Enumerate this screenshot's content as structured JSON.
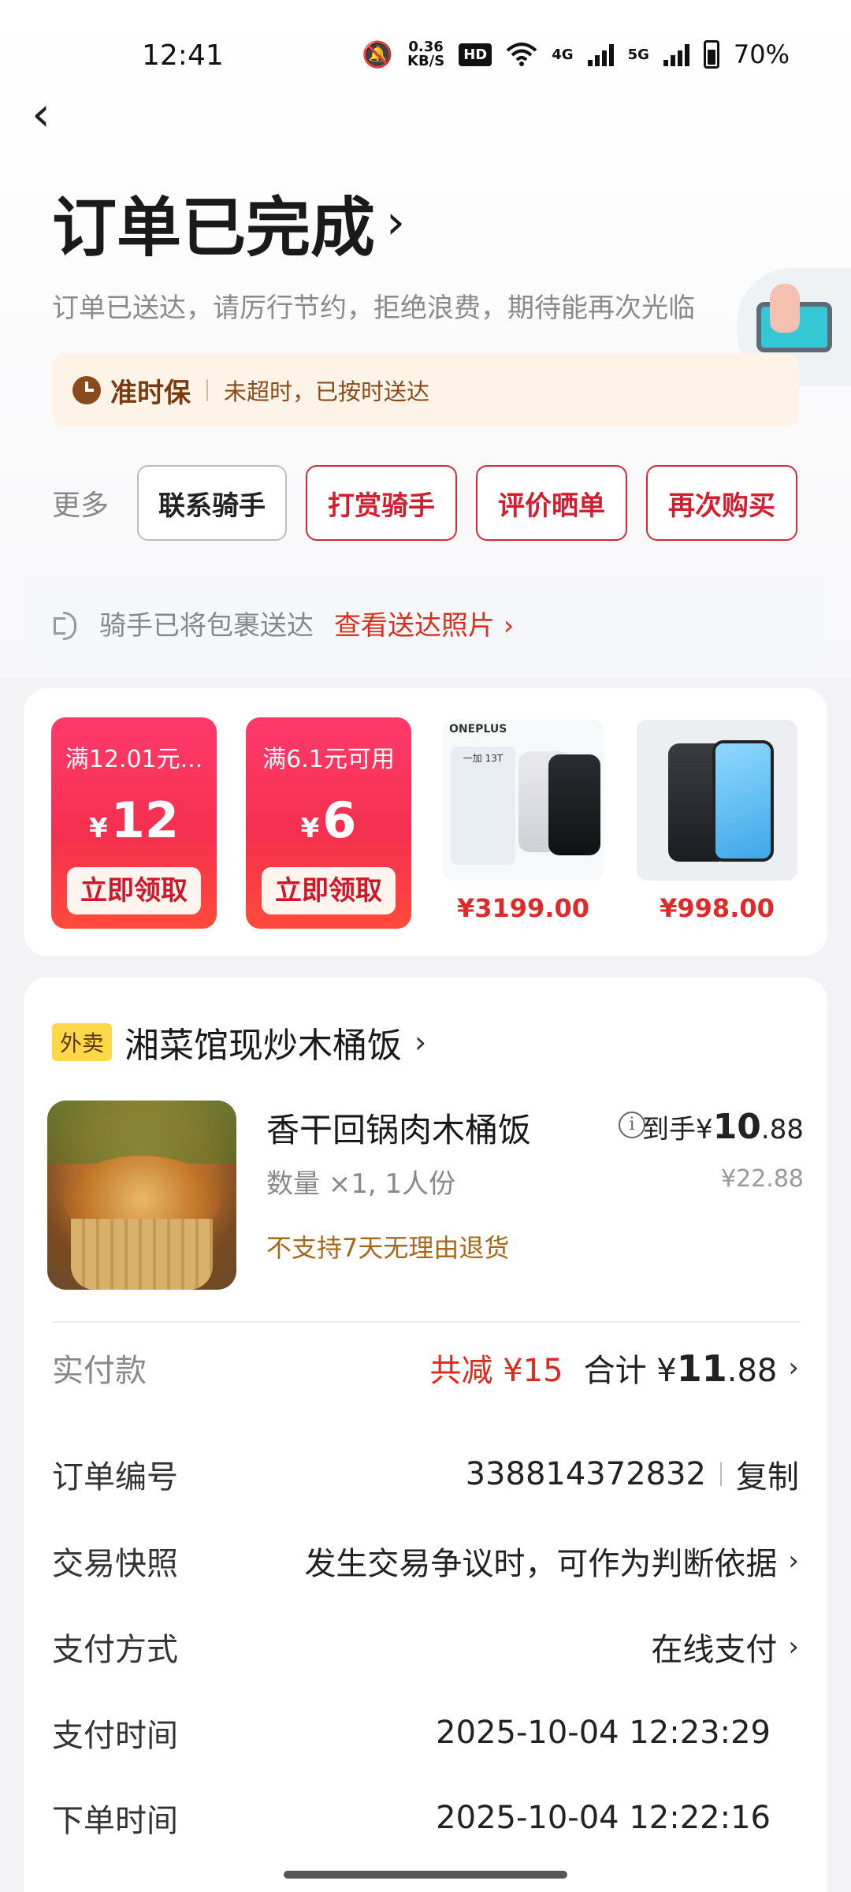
{
  "status_bar": {
    "time": "12:41",
    "speed_value": "0.36",
    "speed_unit": "KB/S",
    "hd_label": "HD",
    "net_4g": "4G",
    "net_5g": "5G",
    "battery": "70%"
  },
  "header": {
    "title": "订单已完成",
    "title_chevron": "›",
    "back_glyph": "‹",
    "subtitle": "订单已送达，请厉行节约，拒绝浪费，期待能再次光临"
  },
  "ontime": {
    "title": "准时保",
    "text": "未超时，已按时送达"
  },
  "actions": {
    "more_label": "更多",
    "buttons": [
      "联系骑手",
      "打赏骑手",
      "评价晒单",
      "再次购买"
    ]
  },
  "rider": {
    "text": "骑手已将包裹送达",
    "link": "查看送达照片 ›"
  },
  "recommend": {
    "coupons": [
      {
        "condition": "满12.01元...",
        "currency": "¥",
        "amount": "12",
        "button": "立即领取"
      },
      {
        "condition": "满6.1元可用",
        "currency": "¥",
        "amount": "6",
        "button": "立即领取"
      }
    ],
    "products": [
      {
        "price": "¥3199.00",
        "brand": "ONEPLUS",
        "model": "一加 13T"
      },
      {
        "price": "¥998.00"
      }
    ]
  },
  "store": {
    "tag": "外卖",
    "name": "湘菜馆现炒木桶饭",
    "chevron": "›"
  },
  "item": {
    "name": "香干回锅肉木桶饭",
    "qty": "数量 ×1, 1人份",
    "note": "不支持7天无理由退货",
    "final_label": "到手¥",
    "final_int": "10",
    "final_dec": ".88",
    "original_price": "¥22.88"
  },
  "payment": {
    "label": "实付款",
    "discount": "共减 ¥15",
    "total_label": "合计 ¥",
    "total_int": "11",
    "total_dec": ".88"
  },
  "details": {
    "order_no_label": "订单编号",
    "order_no": "338814372832",
    "copy": "复制",
    "snapshot_label": "交易快照",
    "snapshot_value": "发生交易争议时，可作为判断依据",
    "pay_method_label": "支付方式",
    "pay_method_value": "在线支付",
    "pay_time_label": "支付时间",
    "pay_time_value": "2025-10-04 12:23:29",
    "order_time_label": "下单时间",
    "order_time_value": "2025-10-04 12:22:16"
  }
}
